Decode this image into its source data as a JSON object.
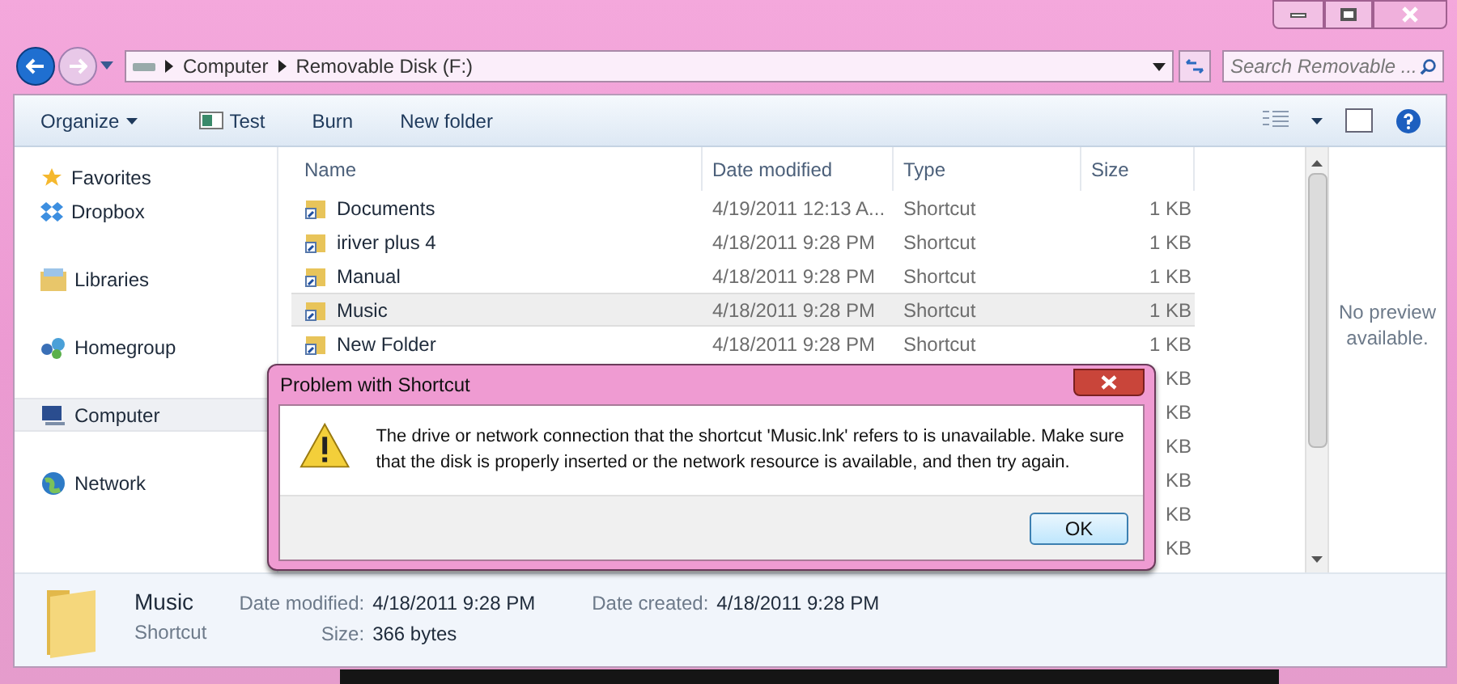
{
  "address": {
    "crumbs": [
      "Computer",
      "Removable Disk (F:)"
    ]
  },
  "search": {
    "placeholder": "Search Removable ..."
  },
  "toolbar": [
    "Organize",
    "Test",
    "Burn",
    "New folder"
  ],
  "sidebar": {
    "items": [
      {
        "label": "Favorites",
        "kind": "star",
        "selected": false
      },
      {
        "label": "Dropbox",
        "kind": "dropbox",
        "selected": false
      },
      {
        "label": "Libraries",
        "kind": "library",
        "selected": false
      },
      {
        "label": "Homegroup",
        "kind": "homegroup",
        "selected": false
      },
      {
        "label": "Computer",
        "kind": "computer",
        "selected": true
      },
      {
        "label": "Network",
        "kind": "network",
        "selected": false
      }
    ]
  },
  "table": {
    "columns": [
      "Name",
      "Date modified",
      "Type",
      "Size"
    ],
    "rows": [
      {
        "name": "Documents",
        "date": "4/19/2011 12:13 A...",
        "type": "Shortcut",
        "size": "1 KB",
        "selected": false
      },
      {
        "name": "iriver plus 4",
        "date": "4/18/2011 9:28 PM",
        "type": "Shortcut",
        "size": "1 KB",
        "selected": false
      },
      {
        "name": "Manual",
        "date": "4/18/2011 9:28 PM",
        "type": "Shortcut",
        "size": "1 KB",
        "selected": false
      },
      {
        "name": "Music",
        "date": "4/18/2011 9:28 PM",
        "type": "Shortcut",
        "size": "1 KB",
        "selected": true
      },
      {
        "name": "New Folder",
        "date": "4/18/2011 9:28 PM",
        "type": "Shortcut",
        "size": "1 KB",
        "selected": false
      },
      {
        "size": "KB",
        "selected": false
      },
      {
        "size": "KB",
        "selected": false
      },
      {
        "size": "KB",
        "selected": false
      },
      {
        "size": "KB",
        "selected": false
      },
      {
        "size": "KB",
        "selected": false
      },
      {
        "size": "KB",
        "selected": false
      }
    ]
  },
  "preview": "No preview available.",
  "details": {
    "name": "Music",
    "type": "Shortcut",
    "fields": [
      {
        "label": "Date modified:",
        "value": "4/18/2011 9:28 PM"
      },
      {
        "label": "Size:",
        "value": "366 bytes"
      },
      {
        "label": "Date created:",
        "value": "4/18/2011 9:28 PM"
      }
    ]
  },
  "dialog": {
    "title": "Problem with Shortcut",
    "message": "The drive or network connection that the shortcut 'Music.lnk' refers to is unavailable. Make sure that the disk is properly inserted or the network resource is available, and then try again.",
    "button": "OK"
  }
}
